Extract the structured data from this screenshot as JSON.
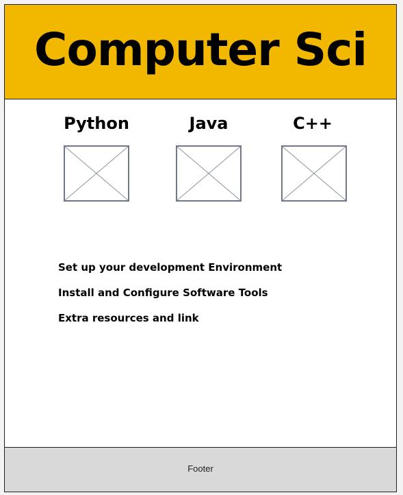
{
  "header": {
    "title": "Computer Sci",
    "background_color": "#f2b800"
  },
  "languages": [
    {
      "label": "Python",
      "image": "image-placeholder-icon"
    },
    {
      "label": "Java",
      "image": "image-placeholder-icon"
    },
    {
      "label": "C++",
      "image": "image-placeholder-icon"
    }
  ],
  "links": [
    {
      "label": "Set up your development Environment"
    },
    {
      "label": "Install and Configure Software Tools"
    },
    {
      "label": "Extra resources and link"
    }
  ],
  "footer": {
    "label": "Footer",
    "background_color": "#d9d9d9"
  }
}
